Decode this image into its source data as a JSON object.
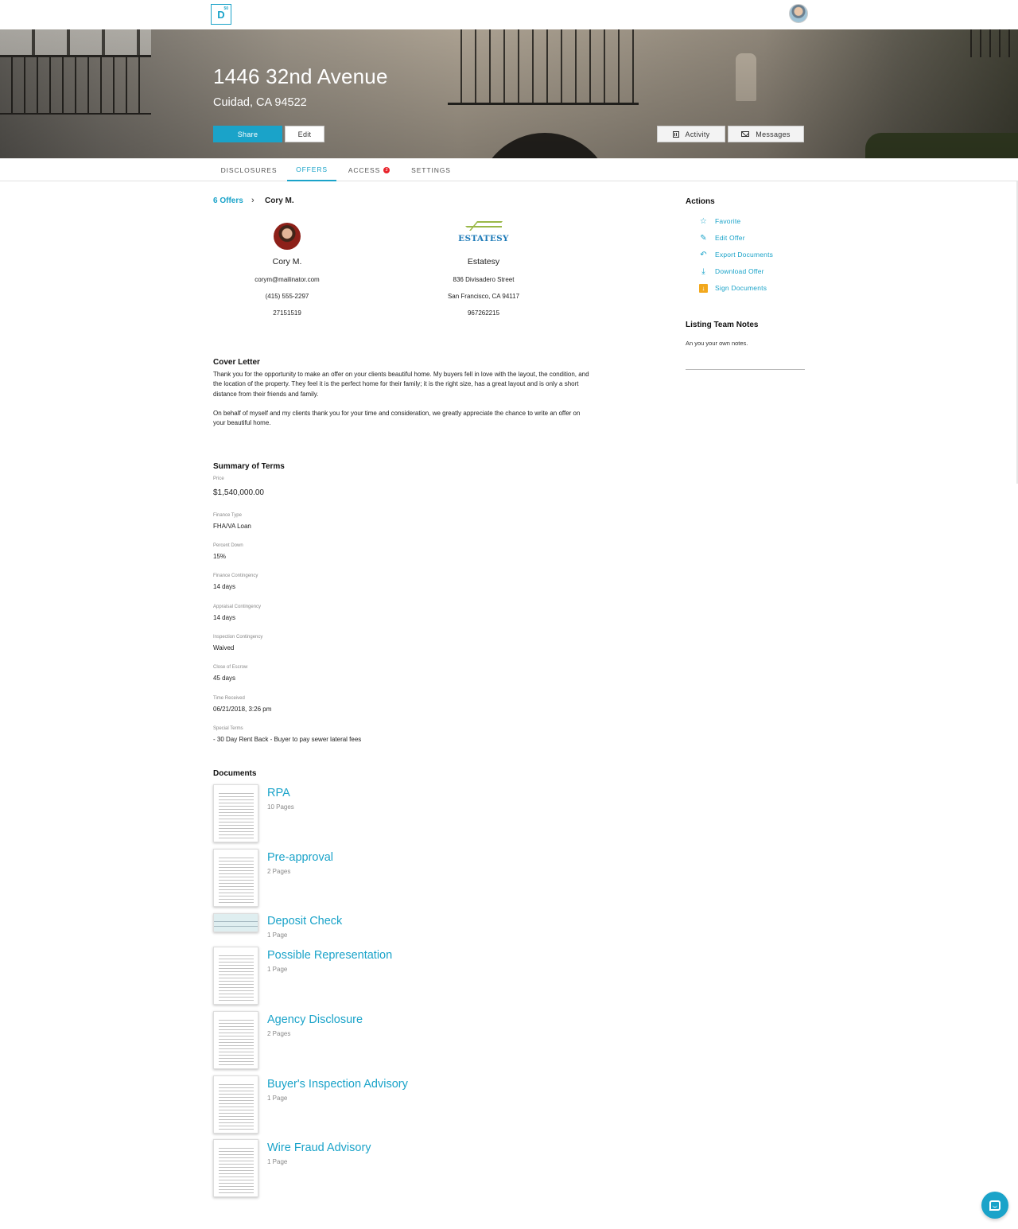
{
  "app": {
    "logo_letter": "D",
    "logo_sup": "50"
  },
  "property": {
    "address": "1446 32nd Avenue",
    "city_line": "Cuidad, CA 94522"
  },
  "hero_buttons": {
    "share": "Share",
    "edit": "Edit",
    "activity": "Activity",
    "messages": "Messages"
  },
  "tabs": [
    {
      "label": "DISCLOSURES",
      "active": false
    },
    {
      "label": "OFFERS",
      "active": true
    },
    {
      "label": "ACCESS",
      "active": false,
      "badge": "2"
    },
    {
      "label": "SETTINGS",
      "active": false
    }
  ],
  "breadcrumb": {
    "parent": "6 Offers",
    "current": "Cory M."
  },
  "buyer_agent": {
    "name": "Cory M.",
    "email": "corym@mailinator.com",
    "phone": "(415) 555-2297",
    "license": "27151519"
  },
  "brokerage": {
    "logo_text": "ESTATESY",
    "name": "Estatesy",
    "street": "836 Divisadero Street",
    "city_line": "San Francisco, CA 94117",
    "license": "967262215"
  },
  "cover_letter": {
    "heading": "Cover Letter",
    "paragraph_1": "Thank you for the opportunity to make an offer on your clients beautiful home. My buyers fell in love with the layout, the condition, and the location of the property. They feel it is the perfect home for their family; it is the right size, has a great layout and is only a short distance from their friends and family.",
    "paragraph_2": "On behalf of myself and my clients thank you for your time and consideration, we greatly appreciate the chance to write an offer on your beautiful home."
  },
  "summary": {
    "heading": "Summary of Terms",
    "terms": [
      {
        "label": "Price",
        "value": "$1,540,000.00"
      },
      {
        "label": "Finance Type",
        "value": "FHA/VA Loan"
      },
      {
        "label": "Percent Down",
        "value": "15%"
      },
      {
        "label": "Finance Contingency",
        "value": "14 days"
      },
      {
        "label": "Appraisal Contingency",
        "value": "14 days"
      },
      {
        "label": "Inspection Contingency",
        "value": "Waived"
      },
      {
        "label": "Close of Escrow",
        "value": "45 days"
      },
      {
        "label": "Time Received",
        "value": "06/21/2018, 3:26 pm"
      },
      {
        "label": "Special Terms",
        "value": "- 30 Day Rent Back - Buyer to pay sewer lateral fees"
      }
    ]
  },
  "documents": {
    "heading": "Documents",
    "items": [
      {
        "title": "RPA",
        "pages": "10 Pages"
      },
      {
        "title": "Pre-approval",
        "pages": "2 Pages"
      },
      {
        "title": "Deposit Check",
        "pages": "1 Page"
      },
      {
        "title": "Possible Representation",
        "pages": "1 Page"
      },
      {
        "title": "Agency Disclosure",
        "pages": "2 Pages"
      },
      {
        "title": "Buyer's Inspection Advisory",
        "pages": "1 Page"
      },
      {
        "title": "Wire Fraud Advisory",
        "pages": "1 Page"
      }
    ]
  },
  "sidebar": {
    "actions_heading": "Actions",
    "actions": [
      {
        "label": "Favorite",
        "icon": "star-icon"
      },
      {
        "label": "Edit Offer",
        "icon": "pencil-icon"
      },
      {
        "label": "Export Documents",
        "icon": "reply-arrow-icon"
      },
      {
        "label": "Download Offer",
        "icon": "download-icon"
      },
      {
        "label": "Sign Documents",
        "icon": "sign-icon"
      }
    ],
    "notes_heading": "Listing Team Notes",
    "notes_text": "An you your own notes."
  },
  "colors": {
    "accent": "#1aa3c9",
    "badge": "#e8232b",
    "sign_icon": "#f2a81d"
  }
}
